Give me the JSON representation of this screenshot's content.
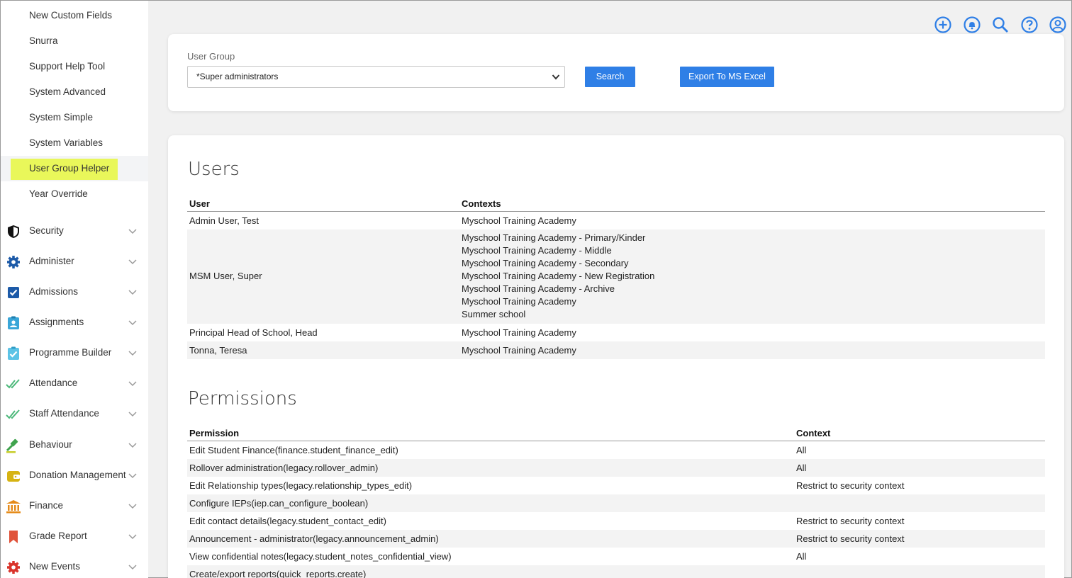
{
  "sidebar": {
    "sub_items": [
      {
        "label": "New Custom Fields"
      },
      {
        "label": "Snurra"
      },
      {
        "label": "Support Help Tool"
      },
      {
        "label": "System Advanced"
      },
      {
        "label": "System Simple"
      },
      {
        "label": "System Variables"
      },
      {
        "label": "User Group Helper",
        "active": true
      },
      {
        "label": "Year Override"
      }
    ],
    "menu_items": [
      {
        "label": "Security",
        "icon": "shield-icon"
      },
      {
        "label": "Administer",
        "icon": "gear-icon"
      },
      {
        "label": "Admissions",
        "icon": "checkbox-icon"
      },
      {
        "label": "Assignments",
        "icon": "clipboard-user-icon"
      },
      {
        "label": "Programme Builder",
        "icon": "clipboard-check-icon"
      },
      {
        "label": "Attendance",
        "icon": "double-check-icon"
      },
      {
        "label": "Staff Attendance",
        "icon": "double-check-icon"
      },
      {
        "label": "Behaviour",
        "icon": "gavel-icon"
      },
      {
        "label": "Donation Management",
        "icon": "wallet-icon"
      },
      {
        "label": "Finance",
        "icon": "bank-icon"
      },
      {
        "label": "Grade Report",
        "icon": "bookmark-icon"
      },
      {
        "label": "New Events",
        "icon": "cog-red-icon"
      }
    ]
  },
  "topbar": {
    "icons": [
      "add-circle-icon",
      "bell-icon",
      "search-icon",
      "help-icon",
      "user-icon"
    ],
    "accent_color": "#2f7fe6"
  },
  "filter": {
    "label": "User Group",
    "selected_value": "*Super administrators",
    "search_label": "Search",
    "export_label": "Export To MS Excel"
  },
  "users": {
    "title": "Users",
    "col_user": "User",
    "col_contexts": "Contexts",
    "rows": [
      {
        "user": "Admin User, Test",
        "contexts": [
          "Myschool Training Academy"
        ]
      },
      {
        "user": "MSM User, Super",
        "contexts": [
          "Myschool Training Academy - Primary/Kinder",
          "Myschool Training Academy - Middle",
          "Myschool Training Academy - Secondary",
          "Myschool Training Academy - New Registration",
          "Myschool Training Academy - Archive",
          "Myschool Training Academy",
          "Summer school"
        ]
      },
      {
        "user": "Principal Head of School, Head",
        "contexts": [
          "Myschool Training Academy"
        ]
      },
      {
        "user": "Tonna, Teresa",
        "contexts": [
          "Myschool Training Academy"
        ]
      }
    ]
  },
  "permissions": {
    "title": "Permissions",
    "col_permission": "Permission",
    "col_context": "Context",
    "rows": [
      {
        "permission": "Edit Student Finance(finance.student_finance_edit)",
        "context": "All"
      },
      {
        "permission": "Rollover administration(legacy.rollover_admin)",
        "context": "All"
      },
      {
        "permission": "Edit Relationship types(legacy.relationship_types_edit)",
        "context": "Restrict to security context"
      },
      {
        "permission": "Configure IEPs(iep.can_configure_boolean)",
        "context": ""
      },
      {
        "permission": "Edit contact details(legacy.student_contact_edit)",
        "context": "Restrict to security context"
      },
      {
        "permission": "Announcement - administrator(legacy.announcement_admin)",
        "context": "Restrict to security context"
      },
      {
        "permission": "View confidential notes(legacy.student_notes_confidential_view)",
        "context": "All"
      },
      {
        "permission": "Create/export reports(quick_reports.create)",
        "context": ""
      }
    ]
  }
}
